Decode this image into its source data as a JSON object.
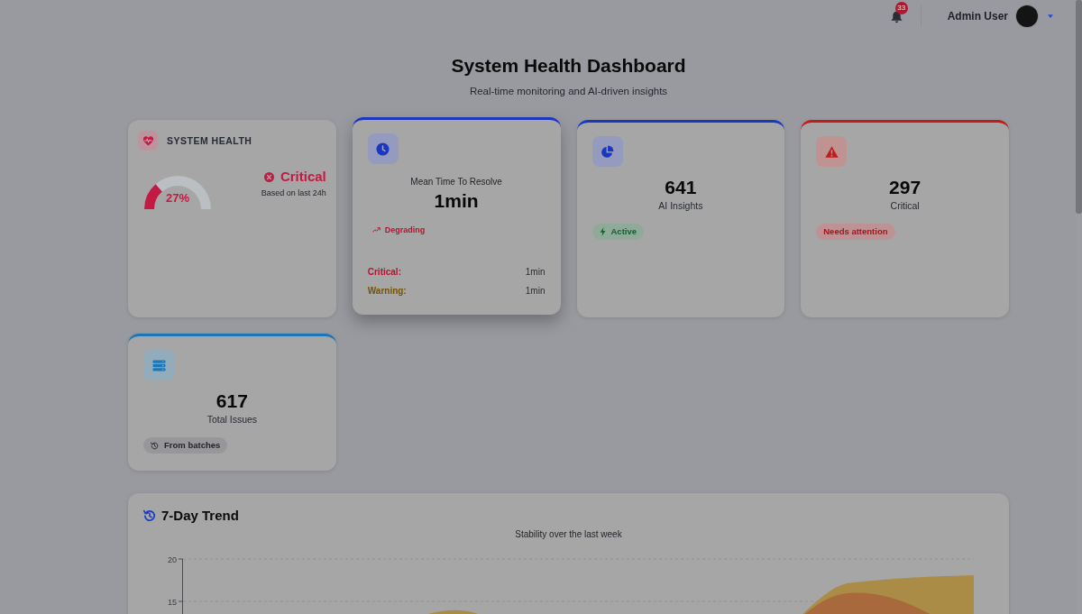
{
  "topbar": {
    "notification_count": "33",
    "user_name": "Admin User"
  },
  "header": {
    "title": "System Health Dashboard",
    "subtitle": "Real-time monitoring and AI-driven insights"
  },
  "cards": [
    {
      "kind": "health",
      "color": "#c21a42",
      "hovered": false,
      "title": "SYSTEM HEALTH",
      "gauge": {
        "level": 0.27,
        "reading": "27%"
      },
      "status": "Critical",
      "status_note": "Based on last 24h"
    },
    {
      "kind": "mttr",
      "color": "#1c37bf",
      "hovered": true,
      "label": "Mean Time To Resolve",
      "value": "1min",
      "trend": "Degrading",
      "breakdown": [
        {
          "label": "Critical:",
          "value": "1min",
          "color": "#b3152f"
        },
        {
          "label": "Warning:",
          "value": "1min",
          "color": "#765400"
        }
      ]
    },
    {
      "kind": "insights",
      "color": "#1c37bf",
      "hovered": false,
      "value": "641",
      "label": "AI Insights",
      "badge": {
        "label": "Active",
        "color": "#0d642e"
      }
    },
    {
      "kind": "alerts",
      "color": "#c41a1a",
      "hovered": false,
      "value": "297",
      "label": "Critical",
      "badge": {
        "label": "Needs attention",
        "color": "#a8141c"
      }
    },
    {
      "kind": "issues",
      "color": "#1a78b8",
      "hovered": false,
      "value": "617",
      "label": "Total Issues",
      "badge": {
        "label": "From batches",
        "color": "#23262c"
      }
    }
  ],
  "trend_panel": {
    "title": "7-Day Trend",
    "subtitle": "Stability over the last week",
    "y_tick_labels": [
      "20",
      "15"
    ]
  }
}
